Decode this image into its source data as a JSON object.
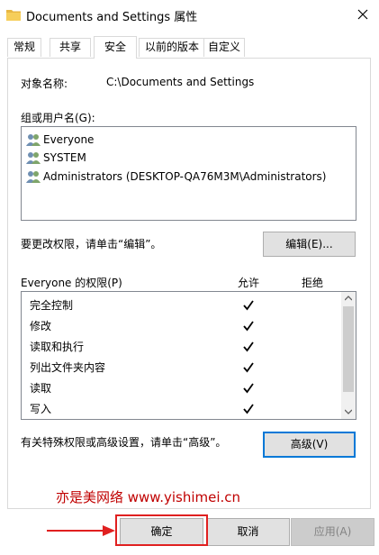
{
  "window": {
    "title": "Documents and Settings 属性",
    "close_icon": "close-icon",
    "folder_icon": "folder-icon"
  },
  "tabs": [
    {
      "label": "常规",
      "active": false
    },
    {
      "label": "共享",
      "active": false
    },
    {
      "label": "安全",
      "active": true
    },
    {
      "label": "以前的版本",
      "active": false
    },
    {
      "label": "自定义",
      "active": false
    }
  ],
  "security": {
    "object_name_label": "对象名称:",
    "object_name_value": "C:\\Documents and Settings",
    "groups_label": "组或用户名(G):",
    "users": [
      {
        "name": "Everyone",
        "selected": false
      },
      {
        "name": "SYSTEM",
        "selected": false
      },
      {
        "name": "Administrators (DESKTOP-QA76M3M\\Administrators)",
        "selected": false
      }
    ],
    "change_hint": "要更改权限，请单击“编辑”。",
    "edit_button": "编辑(E)...",
    "permissions_title": "Everyone 的权限(P)",
    "allow_header": "允许",
    "deny_header": "拒绝",
    "permissions": [
      {
        "name": "完全控制",
        "allow": true,
        "deny": false
      },
      {
        "name": "修改",
        "allow": true,
        "deny": false
      },
      {
        "name": "读取和执行",
        "allow": true,
        "deny": false
      },
      {
        "name": "列出文件夹内容",
        "allow": true,
        "deny": false
      },
      {
        "name": "读取",
        "allow": true,
        "deny": false
      },
      {
        "name": "写入",
        "allow": true,
        "deny": false
      }
    ],
    "advanced_hint": "有关特殊权限或高级设置，请单击“高级”。",
    "advanced_button": "高级(V)"
  },
  "watermark": "亦是美网络 www.yishimei.cn",
  "footer": {
    "ok_button": "确定",
    "cancel_button": "取消",
    "apply_button": "应用(A)"
  },
  "colors": {
    "accent": "#0078d7",
    "highlight_box": "#e02020",
    "watermark": "#c00000"
  }
}
